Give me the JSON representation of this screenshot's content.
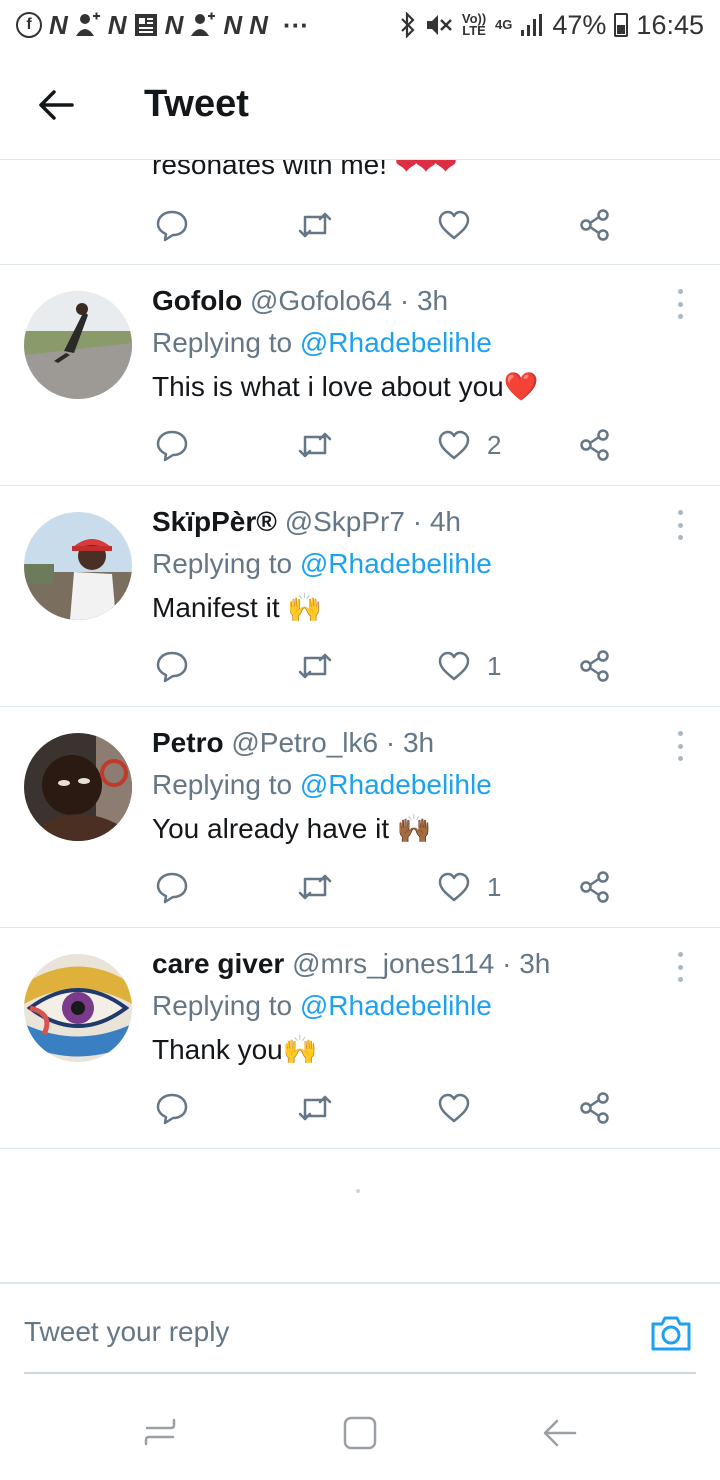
{
  "status_bar": {
    "left_icons": [
      "facebook-icon",
      "N",
      "add-friend-icon",
      "N",
      "news-icon",
      "N",
      "add-friend-icon",
      "N",
      "N"
    ],
    "more": "···",
    "volte": "Vo)) LTE",
    "network": "4G",
    "battery": "47%",
    "time": "16:45"
  },
  "header": {
    "title": "Tweet"
  },
  "partial_tweet": {
    "text": "resonates with me!",
    "emoji": "❤❤❤"
  },
  "tweets": [
    {
      "name": "Gofolo",
      "handle": "@Gofolo64",
      "time": "· 3h",
      "replying_prefix": "Replying to",
      "replying_to": "@Rhadebelihle",
      "text": "This is what i love about you",
      "emoji": "❤️",
      "likes": "2"
    },
    {
      "name": "SkïpPèr®",
      "handle": "@SkpPr7",
      "time": "· 4h",
      "replying_prefix": "Replying to",
      "replying_to": "@Rhadebelihle",
      "text": "Manifest it",
      "emoji": "🙌",
      "likes": "1"
    },
    {
      "name": "Petro",
      "handle": "@Petro_lk6",
      "time": "· 3h",
      "replying_prefix": "Replying to",
      "replying_to": "@Rhadebelihle",
      "text": "You already have it",
      "emoji": "🙌🏾",
      "likes": "1"
    },
    {
      "name": "care giver",
      "handle": "@mrs_jones114",
      "time": "· 3h",
      "replying_prefix": "Replying to",
      "replying_to": "@Rhadebelihle",
      "text": "Thank you",
      "emoji": "🙌",
      "likes": ""
    }
  ],
  "composer": {
    "placeholder": "Tweet your reply"
  },
  "colors": {
    "accent": "#1da1f2",
    "secondary_text": "#657786",
    "divider": "#e1e8ed",
    "heart": "#dd2e44"
  }
}
